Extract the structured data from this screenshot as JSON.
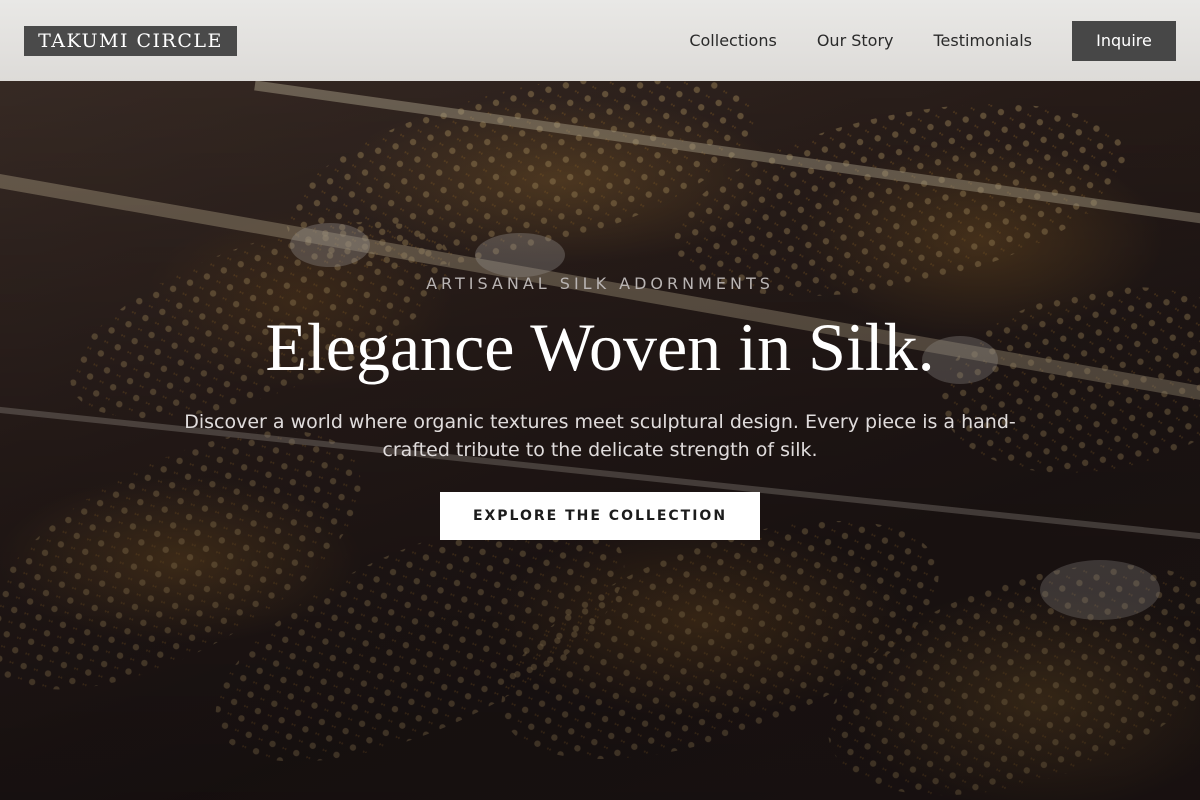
{
  "header": {
    "logo_text": "TAKUMI CIRCLE",
    "nav": [
      {
        "label": "Collections"
      },
      {
        "label": "Our Story"
      },
      {
        "label": "Testimonials"
      }
    ],
    "inquire_label": "Inquire"
  },
  "hero": {
    "eyebrow": "ARTISANAL SILK ADORNMENTS",
    "headline": "Elegance Woven in Silk.",
    "subtext": "Discover a world where organic textures meet sculptural design. Every piece is a hand-crafted tribute to the delicate strength of silk.",
    "cta_label": "EXPLORE THE COLLECTION",
    "background_image": "jewelry bangles display"
  },
  "colors": {
    "header_bg": "#e4e3e1",
    "logo_bg": "#4a4a4a",
    "inquire_bg": "#474747",
    "cta_bg": "#ffffff",
    "headline_text": "#ffffff"
  }
}
